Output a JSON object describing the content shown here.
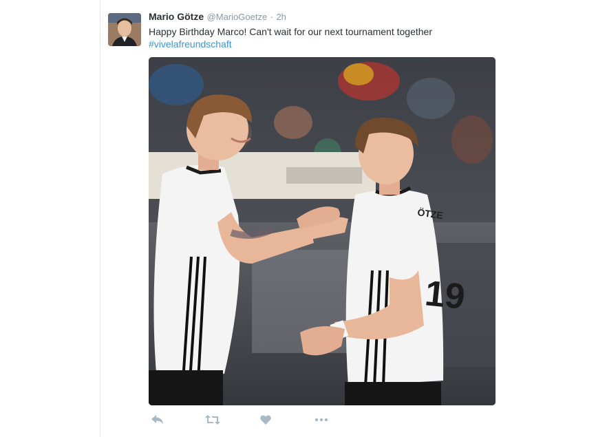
{
  "tweet": {
    "author_name": "Mario Götze",
    "author_handle": "@MarioGoetze",
    "separator": "·",
    "timestamp": "2h",
    "text": "Happy Birthday Marco! Can't wait for our next tournament together",
    "hashtag": "#vivelafreundschaft",
    "jersey_number": "19",
    "jersey_name": "ÖTZE"
  },
  "icons": {
    "avatar": "profile-photo",
    "reply": "reply-icon",
    "retweet": "retweet-icon",
    "like": "heart-icon",
    "more": "more-dots-icon"
  },
  "colors": {
    "link": "#3b94d9",
    "muted": "#8899a6",
    "text": "#292f33",
    "action_icon": "#aab8c2"
  }
}
